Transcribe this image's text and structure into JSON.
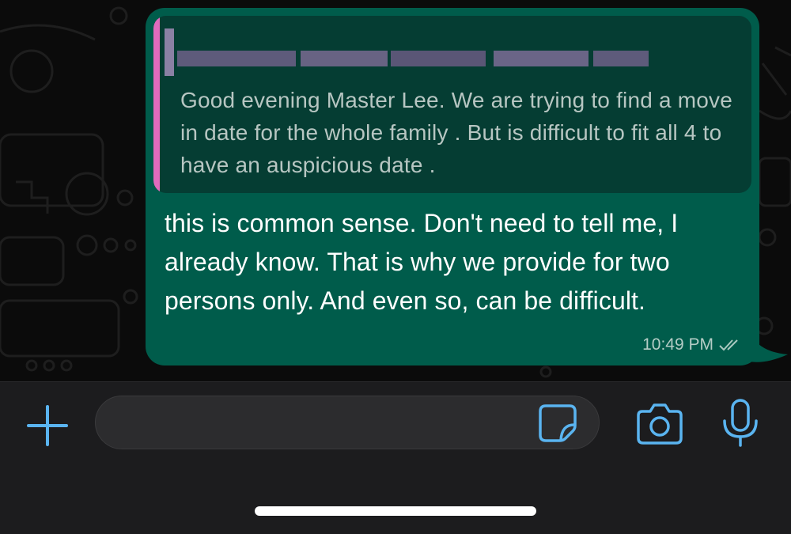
{
  "chat": {
    "quoted_message": {
      "author_redacted": true,
      "text": "Good evening Master Lee. We are trying to find a move in date for the whole family . But is difficult to fit all 4 to have an auspicious date ."
    },
    "message": {
      "text": "this is common sense. Don't need to tell me, I already know. That is why we provide for two persons only. And even so, can be difficult.",
      "time": "10:49 PM",
      "status_icon": "double-check-icon"
    }
  },
  "composer": {
    "input_value": "",
    "attach_icon": "plus-icon",
    "sticker_icon": "sticker-icon",
    "camera_icon": "camera-icon",
    "mic_icon": "microphone-icon"
  },
  "colors": {
    "outgoing_bubble": "#005c4b",
    "quote_background": "#053d33",
    "quote_accent": "#e06bbd",
    "icon_blue": "#5ab4f0",
    "background": "#0b0b0b"
  }
}
